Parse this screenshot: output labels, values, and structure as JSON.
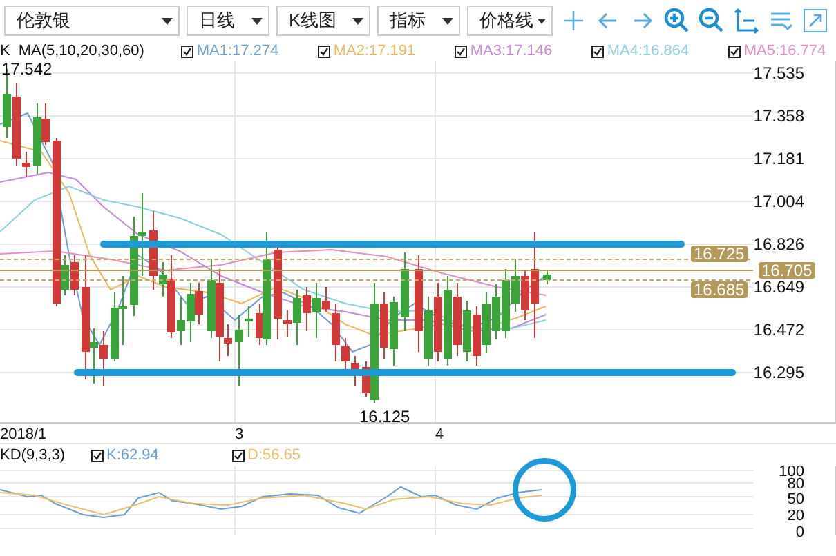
{
  "toolbar": {
    "dropdowns": [
      {
        "value": "伦敦银"
      },
      {
        "value": "日线"
      },
      {
        "value": "K线图"
      },
      {
        "value": "指标"
      },
      {
        "value": "价格线"
      }
    ]
  },
  "legend": {
    "label": "K",
    "indicator": "MA(5,10,20,30,60)",
    "items": [
      {
        "label": "MA1:17.274",
        "checked": true,
        "color": "#6f9fd0"
      },
      {
        "label": "MA2:17.191",
        "checked": true,
        "color": "#eeb860"
      },
      {
        "label": "MA3:17.146",
        "checked": true,
        "color": "#c58ad8"
      },
      {
        "label": "MA4:16.864",
        "checked": true,
        "color": "#8cd0e0"
      },
      {
        "label": "MA5:16.774",
        "checked": true,
        "color": "#e58fc6"
      }
    ]
  },
  "price_chart": {
    "high_label": "17.542",
    "low_label": "16.125",
    "axis": [
      "17.535",
      "17.358",
      "17.181",
      "17.004",
      "16.826",
      "16.649",
      "16.472",
      "16.295"
    ],
    "price_tags": [
      {
        "value": "16.725",
        "kind": "upper"
      },
      {
        "value": "16.705",
        "kind": "current"
      },
      {
        "value": "16.685",
        "kind": "lower"
      }
    ]
  },
  "x_axis": [
    "2018/1",
    "3",
    "4"
  ],
  "kd": {
    "indicator": "KD(9,3,3)",
    "items": [
      {
        "label": "K:62.94",
        "checked": true,
        "color": "#6a9fd0"
      },
      {
        "label": "D:56.65",
        "checked": true,
        "color": "#e8c070"
      }
    ],
    "axis": [
      "100",
      "80",
      "50",
      "20",
      "0"
    ]
  }
}
